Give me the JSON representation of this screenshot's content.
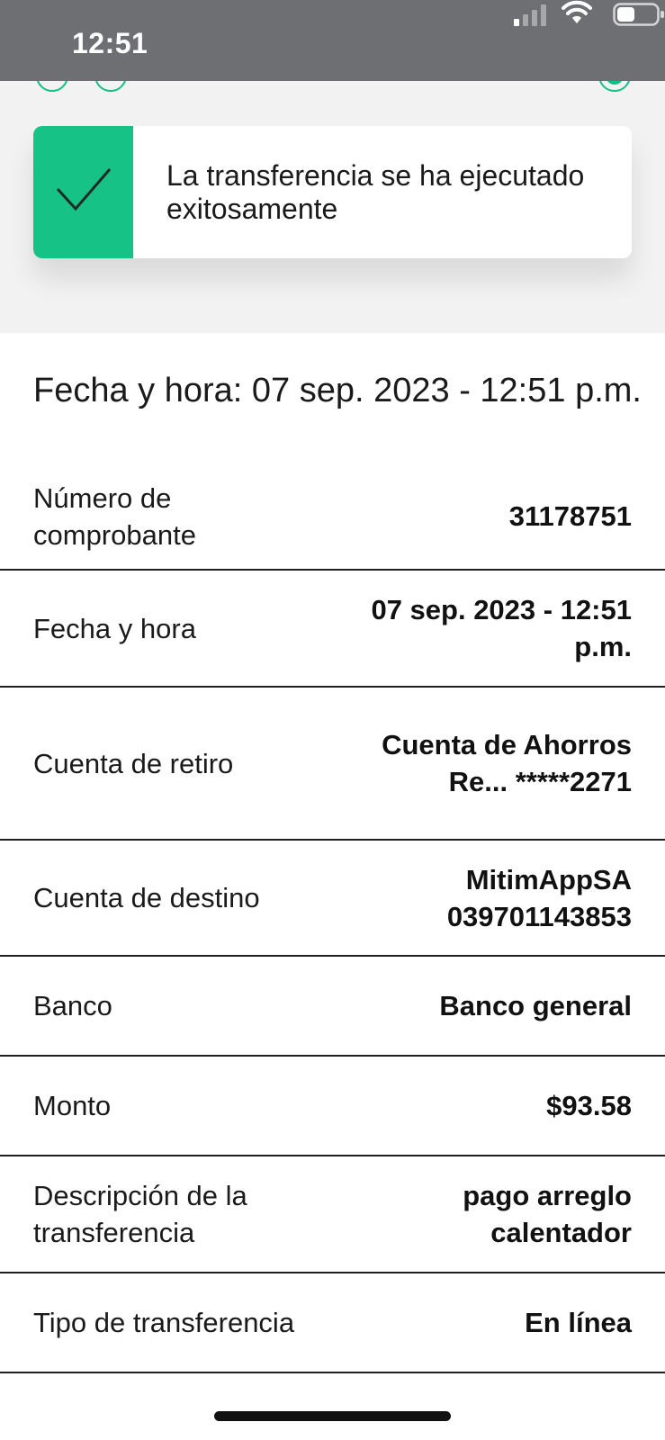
{
  "status_bar": {
    "time": "12:51"
  },
  "success": {
    "message": "La transferencia se ha ejecutado exitosamente"
  },
  "datetime_title": "Fecha y hora: 07 sep. 2023 - 12:51 p.m.",
  "details": [
    {
      "label": "Número de comprobante",
      "value": "31178751"
    },
    {
      "label": "Fecha y hora",
      "value": "07 sep. 2023 - 12:51 p.m."
    },
    {
      "label": "Cuenta de retiro",
      "value": "Cuenta de Ahorros Re... *****2271"
    },
    {
      "label": "Cuenta de destino",
      "value": "MitimAppSA 039701143853"
    },
    {
      "label": "Banco",
      "value": "Banco general"
    },
    {
      "label": "Monto",
      "value": "$93.58"
    },
    {
      "label": "Descripción de la transferencia",
      "value": "pago arreglo calentador"
    },
    {
      "label": "Tipo de transferencia",
      "value": "En línea"
    }
  ],
  "colors": {
    "accent": "#17c286",
    "status_bar": "#6e6f73"
  }
}
